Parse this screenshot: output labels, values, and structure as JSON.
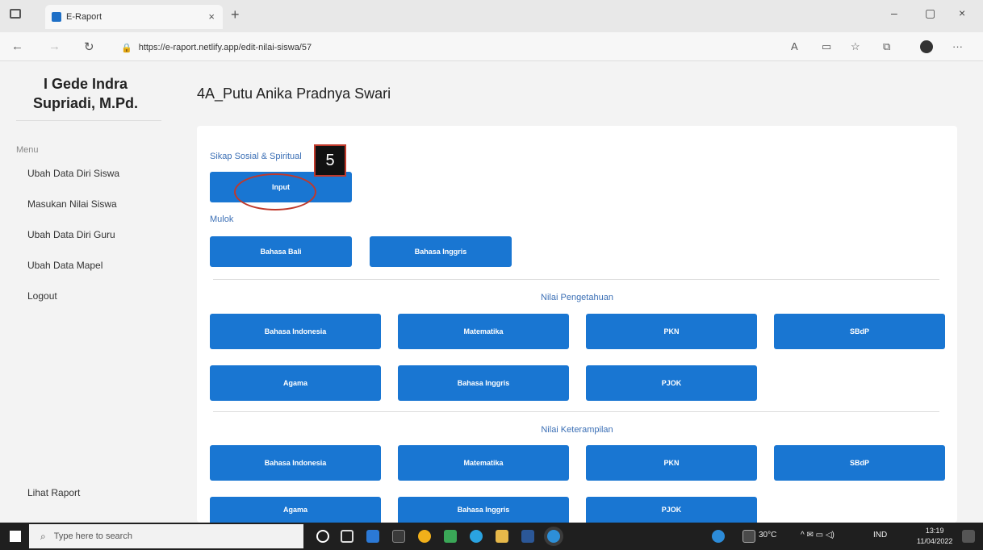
{
  "browser": {
    "tab_title": "E-Raport",
    "tab_close": "×",
    "new_tab": "+",
    "url": "https://e-raport.netlify.app/edit-nilai-siswa/57",
    "window_controls": [
      "–",
      "▢",
      "×"
    ]
  },
  "sidebar": {
    "teacher_name": "I Gede Indra Supriadi, M.Pd.",
    "menu_label": "Menu",
    "items": [
      {
        "label": "Ubah Data Diri Siswa"
      },
      {
        "label": "Masukan Nilai Siswa"
      },
      {
        "label": "Ubah Data Diri Guru"
      },
      {
        "label": "Ubah Data Mapel"
      },
      {
        "label": "Logout"
      }
    ],
    "report_link": "Lihat Raport"
  },
  "main": {
    "student_title": "4A_Putu Anika Pradnya Swari",
    "sikap": {
      "label": "Sikap Sosial & Spiritual",
      "button": "Input"
    },
    "mulok": {
      "label": "Mulok",
      "buttons": [
        "Bahasa Bali",
        "Bahasa Inggris"
      ]
    },
    "pengetahuan": {
      "label": "Nilai Pengetahuan",
      "buttons": [
        "Bahasa Indonesia",
        "Matematika",
        "PKN",
        "SBdP",
        "Agama",
        "Bahasa Inggris",
        "PJOK"
      ]
    },
    "keterampilan": {
      "label": "Nilai Keterampilan",
      "buttons": [
        "Bahasa Indonesia",
        "Matematika",
        "PKN",
        "SBdP",
        "Agama",
        "Bahasa Inggris",
        "PJOK"
      ]
    }
  },
  "annotation": {
    "step": "5"
  },
  "taskbar": {
    "search_placeholder": "Type here to search",
    "weather": "30°C",
    "lang": "IND",
    "time": "13:19",
    "date": "11/04/2022"
  }
}
